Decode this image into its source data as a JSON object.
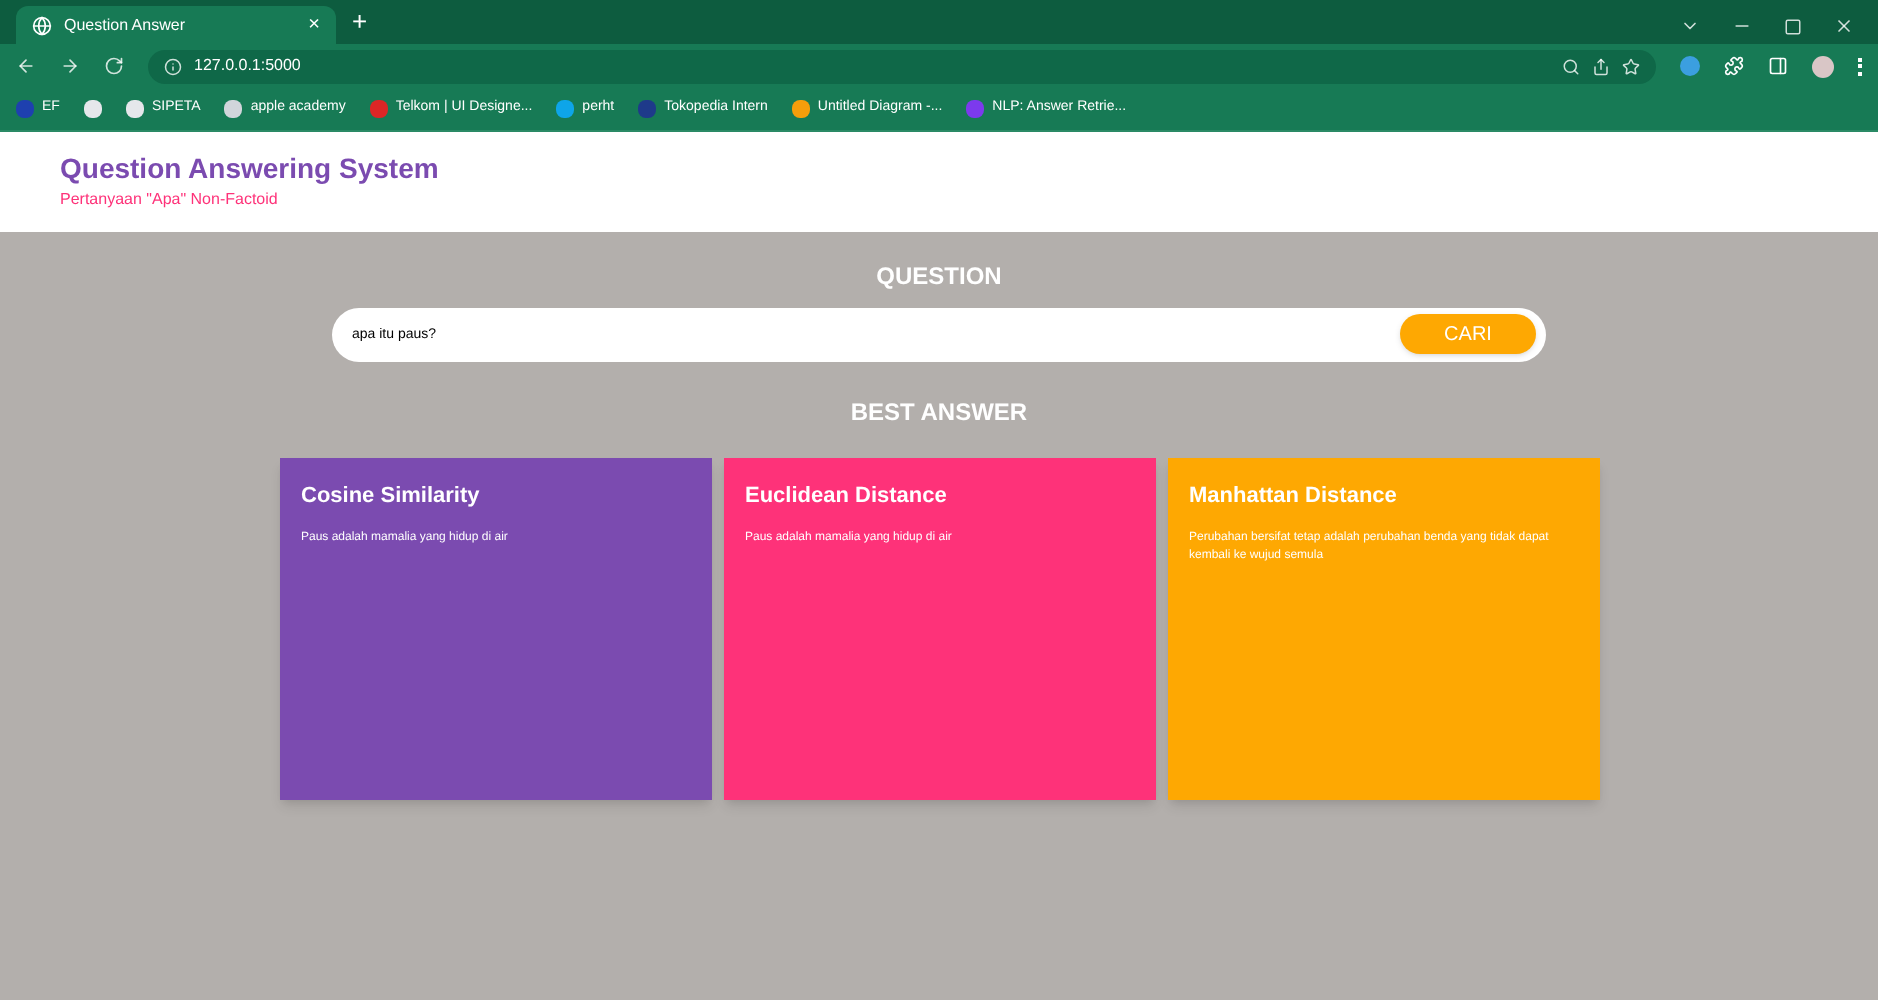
{
  "browser": {
    "tab_title": "Question Answer",
    "new_tab": "+",
    "close": "×",
    "address": "127.0.0.1:5000",
    "bookmarks": [
      {
        "label": "EF",
        "color": "#1e40af"
      },
      {
        "color": "#e5e7eb"
      },
      {
        "label": "SIPETA",
        "color": "#e5e7eb"
      },
      {
        "label": "apple academy",
        "color": "#d1d5db"
      },
      {
        "label": "Telkom | UI Designe...",
        "color": "#dc2626"
      },
      {
        "label": "perht",
        "color": "#0ea5e9"
      },
      {
        "label": "Tokopedia Intern",
        "color": "#1e3a8a"
      },
      {
        "label": "Untitled Diagram -...",
        "color": "#f59e0b"
      },
      {
        "label": "NLP: Answer Retrie...",
        "color": "#7c3aed"
      }
    ]
  },
  "header": {
    "title": "Question Answering System",
    "subtitle": "Pertanyaan \"Apa\" Non-Factoid"
  },
  "question": {
    "heading": "QUESTION",
    "value": "apa itu paus?",
    "button": "CARI"
  },
  "answers_heading": "BEST ANSWER",
  "answers": [
    {
      "title": "Cosine Similarity",
      "text": "Paus adalah mamalia yang hidup di air",
      "color": "#7b4bb0"
    },
    {
      "title": "Euclidean Distance",
      "text": "Paus adalah mamalia yang hidup di air",
      "color": "#fe3279"
    },
    {
      "title": "Manhattan Distance",
      "text": "Perubahan bersifat tetap adalah perubahan benda yang tidak dapat kembali ke wujud semula",
      "color": "#fea802"
    }
  ]
}
